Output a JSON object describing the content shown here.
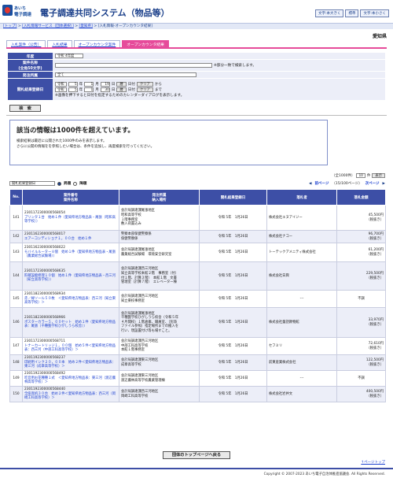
{
  "header": {
    "logo_line1": "あいち",
    "logo_line2": "電子調達",
    "title": "電子調達共同システム（物品等）",
    "buttons": [
      "文字:本大きく",
      "標準",
      "文字:本小さく"
    ]
  },
  "breadcrumb": {
    "items": [
      "[トップ]",
      "[入札情報サービス（団体選択）]",
      "[愛知県]"
    ],
    "current": "[入札情報-オープンカウンタ結果]",
    "sep": " > "
  },
  "prefecture": "愛知県",
  "tabs": [
    "入札案件（公告）",
    "入札結果",
    "オープンカウンタ案件",
    "オープンカウンタ結果"
  ],
  "form": {
    "labels": {
      "year": "年度",
      "case_name": "案件名称",
      "case_name_sub": "(全角50文字)",
      "dept": "発注所属",
      "date": "開札結果登録日"
    },
    "year_value": "令和 4年度",
    "case_note": "※部分一致で検索します。",
    "dept_value": "全て",
    "date_from": {
      "era": "令和",
      "y": "5",
      "m": "1",
      "d": "19",
      "unit_y": "年",
      "unit_m": "月",
      "unit_d": "日",
      "btn": "暦",
      "label": "日付",
      "clear": "クリア",
      "suffix": "から"
    },
    "date_to": {
      "era": "令和",
      "y": "5",
      "m": "1",
      "d": "30",
      "unit_y": "年",
      "unit_m": "月",
      "unit_d": "日",
      "btn": "暦",
      "label": "日付",
      "clear": "クリア",
      "suffix": "まで"
    },
    "date_note": "※画像を押下すると日付を指定するためのカレンダーダイアログを表示します。",
    "search_button": "検　索"
  },
  "message": {
    "heading": "該当の情報は1000件を超えています。",
    "lines": [
      "検索結果は最近に公開された1000件のみを表示します。",
      "さらに公開の情報をを参照したい場合は、条件を追加し、再度検索を行ってください。"
    ]
  },
  "pager": {
    "total": "（全1000件）",
    "per_page": "10",
    "per_page_suffix": "件",
    "show_btn": "表示",
    "prev": "前ページ",
    "page_info": "（15/100ページ）",
    "next": "次ページ",
    "sort_key": "開札結果登録日",
    "asc": "昇順",
    "desc": "降順"
  },
  "table": {
    "headers": [
      "No.",
      "案件番号\n案件名称",
      "発注所属\n納入場所",
      "開札結果登録日",
      "落札者",
      "落札金額"
    ],
    "rows": [
      {
        "no": "141",
        "id": "2301172300000568054",
        "name": "プリンタ１台　始め１件（愛知県地方物品表・尾張（昭和高等学校））",
        "dept": "会計局調達課尾張地区\n昭和高等学校\n１階事務室\n敷入荷置込み",
        "date": "令和 5年　1月26日",
        "winner": "株式会社エヌアイジー",
        "amount": "45,500円",
        "tax": "（税抜き）"
      },
      {
        "no": "142",
        "id": "2301162300000568017",
        "name": "エアーコンディショナ１，００台　始め１件",
        "dept": "警察本部保健警察係\n保健警察係",
        "date": "令和 5年　1月26日",
        "winner": "株式会社ナコー",
        "amount": "96,700円",
        "tax": "（税抜き）"
      },
      {
        "no": "143",
        "id": "2301162300000568022",
        "name": "モバイルルーター８個　始め１件（愛知県地方物品表・尾張（農業総合試験場））",
        "dept": "会計局調達課尾張地区\n農業総合試験場　環境安全研究室",
        "date": "令和 5年　1月26日",
        "winner": "トーテックアメニティ株式会社",
        "amount": "61,200円",
        "tax": "（税抜き）"
      },
      {
        "no": "144",
        "id": "2301172300000568635",
        "name": "貯蔵設能修理１０個　始め１件（愛知県地方物品表・西三河（知立高等学校））",
        "dept": "会計局調達課西三河地区\n知立高等学校本館２階　事務室（付）\n付１階、計算３階）　本館１階　文書\n管理室（計算７階）　エレベーター棟",
        "date": "令和 5年　1月26日",
        "winner": "株式会社日興",
        "amount": "229,500円",
        "tax": "（税抜き）"
      },
      {
        "no": "145",
        "id": "2301182300000568934",
        "name": "赤／緑ソール５０枚　＜愛知県地方物品表：西三河（知立東高等学校）＞",
        "dept": "会計局調達課西三河地区\n知立東校事務室",
        "date": "令和 5年　1月26日",
        "winner": "---",
        "amount": "不調",
        "tax": ""
      },
      {
        "no": "146",
        "id": "2301182300000568966",
        "name": "ポスターカラー５，００セット　始め１件（愛知県地方物品表：尾張（千種聾学校ひがしうら校舎））",
        "dept": "会計局調達課尾張地区\n千種聾学校ひがしうら校舎（令和５年\n４月開校）１階倉庫、職員室、（別添\nファイル参照）指定場所までの搬入を\n行い、現設置付け等も場すこと。",
        "date": "令和 5年　1月26日",
        "winner": "株式会社童話教物館",
        "amount": "33,970円",
        "tax": "（税抜き）"
      },
      {
        "no": "147",
        "id": "2301172300000568711",
        "name": "トナーカートリッジ１，００個　始め５件＜愛知県地方物品表：西三河（中部工科高等学校）＞",
        "dept": "会計局調達課西三河地区\n中部工科高等学校\n本館１階事務室",
        "date": "令和 5年　1月26日",
        "winner": "セフミリ",
        "amount": "72,610円",
        "tax": "（税抜き）"
      },
      {
        "no": "148",
        "id": "2301192300000568237",
        "name": "印刷用インク２０，００本　始め２件＜愛知県地方物品表：東三河（成章高等学校）＞",
        "dept": "会計局調達課東三河地区\n成章高等学校",
        "date": "令和 5年　1月26日",
        "winner": "前東産業株式会社",
        "amount": "122,500円",
        "tax": "（税抜き）"
      },
      {
        "no": "149",
        "id": "2301192300000568492",
        "name": "吃音用お花種種１式　＜愛知県地方物品表：東三河（渡辺農林高等学校）＞",
        "dept": "会計局調達課東三河地区\n渡辺農林高等学校農業管理棟",
        "date": "令和 5年　1月26日",
        "winner": "---",
        "amount": "不調",
        "tax": ""
      },
      {
        "no": "150",
        "id": "2301192300000568440",
        "name": "全座席机３０台　始め２件＜愛知県地方物品表：西三河（岡崎工科高等学校）＞",
        "dept": "会計局調達課西三河地区\n岡崎工科高等学校",
        "date": "令和 5年　1月26日",
        "winner": "株式会社岩井文",
        "amount": "400,500円",
        "tax": "（税抜き）"
      }
    ]
  },
  "back_button": "団体のトップページへ戻る",
  "page_top": "↑ページトップ",
  "footer": "Copyright © 2007-2023 あいち電子自治体推進協議会. All Rights Reserved."
}
